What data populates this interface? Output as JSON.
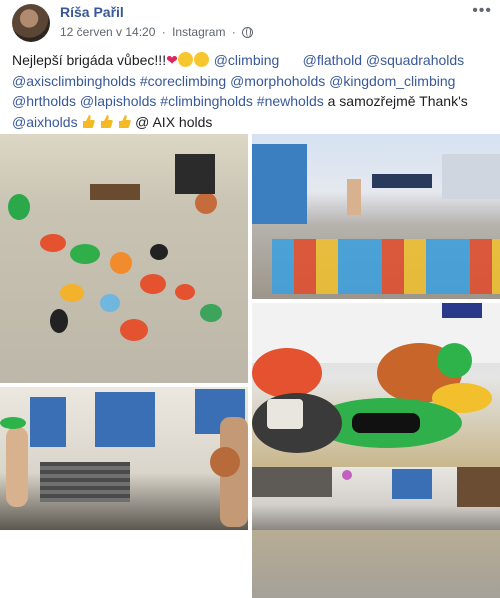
{
  "post": {
    "author": "Ríša Pařil",
    "timestamp": "12 červen v 14:20",
    "separator": "·",
    "source": "Instagram",
    "separator2": "·",
    "more_icon": "more-icon",
    "text_segments": {
      "s1": "Nejlepší brigáda vůbec!!!",
      "s2": "@climbing",
      "s3": "@flathold",
      "s4": "@squadraholds",
      "s5": "@axisclimbingholds",
      "s6": "#coreclimbing",
      "s7": "@morphoholds",
      "s8": "@kingdom_climbing",
      "s9": "@hrtholds",
      "s10": "@lapisholds",
      "s11": "#climbingholds",
      "s12": "#newholds",
      "s13": "a samozřejmě Thank's",
      "s14": "@aixholds",
      "s15": "@ AIX holds"
    }
  },
  "colors": {
    "link": "#385898",
    "meta": "#606770",
    "text": "#1c1e21"
  },
  "photos": [
    {
      "name": "photo-holds-floor"
    },
    {
      "name": "photo-warehouse-yard"
    },
    {
      "name": "photo-holds-sunglasses"
    },
    {
      "name": "photo-man-building"
    },
    {
      "name": "photo-workshop"
    }
  ]
}
